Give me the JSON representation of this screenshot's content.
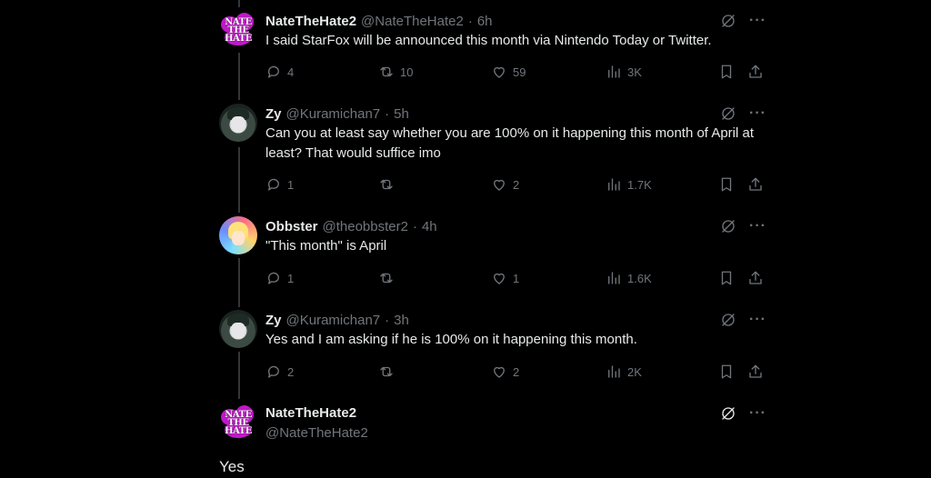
{
  "tweets": [
    {
      "name": "NateTheHate2",
      "handle": "@NateTheHate2",
      "time": "6h",
      "text": "I said StarFox will be announced this month via Nintendo Today or Twitter.",
      "replies": "4",
      "reposts": "10",
      "likes": "59",
      "views": "3K"
    },
    {
      "name": "Zy",
      "handle": "@Kuramichan7",
      "time": "5h",
      "text": "Can you at least say whether you are 100% on it happening this month of April at least? That would suffice imo",
      "replies": "1",
      "reposts": "",
      "likes": "2",
      "views": "1.7K"
    },
    {
      "name": "Obbster",
      "handle": "@theobbster2",
      "time": "4h",
      "text": "\"This month\" is April",
      "replies": "1",
      "reposts": "",
      "likes": "1",
      "views": "1.6K"
    },
    {
      "name": "Zy",
      "handle": "@Kuramichan7",
      "time": "3h",
      "text": "Yes and I am asking if he is 100% on it happening this month.",
      "replies": "2",
      "reposts": "",
      "likes": "2",
      "views": "2K"
    }
  ],
  "main_tweet": {
    "name": "NateTheHate2",
    "handle": "@NateTheHate2",
    "text": "Yes"
  },
  "common": {
    "dot": "·",
    "more": "···",
    "avatar_logo": "NATE THE HATE"
  },
  "colors": {
    "background": "#000000",
    "text": "#e7e9ea",
    "muted": "#71767b",
    "thread_line": "#333639",
    "logo_magenta": "#c018c8"
  }
}
